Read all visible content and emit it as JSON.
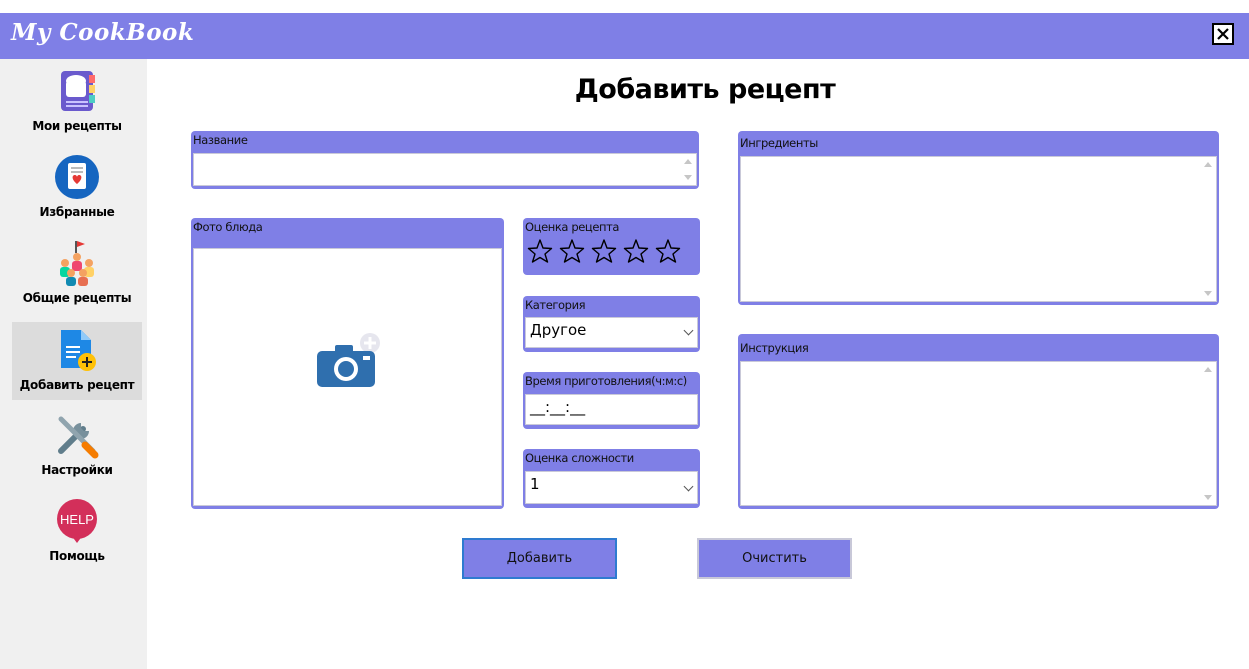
{
  "app": {
    "title": "My CookBook"
  },
  "sidebar": {
    "items": [
      {
        "label": "Мои рецепты",
        "icon": "recipe-book-icon"
      },
      {
        "label": "Избранные",
        "icon": "favorite-recipe-icon"
      },
      {
        "label": "Общие рецепты",
        "icon": "community-icon"
      },
      {
        "label": "Добавить рецепт",
        "icon": "add-document-icon",
        "active": true
      },
      {
        "label": "Настройки",
        "icon": "tools-icon"
      },
      {
        "label": "Помощь",
        "icon": "help-icon",
        "badge": "HELP"
      }
    ]
  },
  "page": {
    "title": "Добавить рецепт"
  },
  "form": {
    "name_label": "Название",
    "name_value": "",
    "photo_label": "Фото блюда",
    "photo_icon": "add-photo-camera-icon",
    "rating_label": "Оценка рецепта",
    "rating_stars": 5,
    "rating_value": 0,
    "category_label": "Категория",
    "category_value": "Другое",
    "time_label": "Время приготовления(ч:м:с)",
    "time_value": "__:__:__",
    "difficulty_label": "Оценка сложности",
    "difficulty_value": "1",
    "ingredients_label": "Ингредиенты",
    "ingredients_value": "",
    "instructions_label": "Инструкция",
    "instructions_value": ""
  },
  "buttons": {
    "add": "Добавить",
    "clear": "Очистить"
  },
  "colors": {
    "accent": "#7f7fe6",
    "sidebar_bg": "#f0f0f0",
    "active_item": "#dcdcdc"
  }
}
